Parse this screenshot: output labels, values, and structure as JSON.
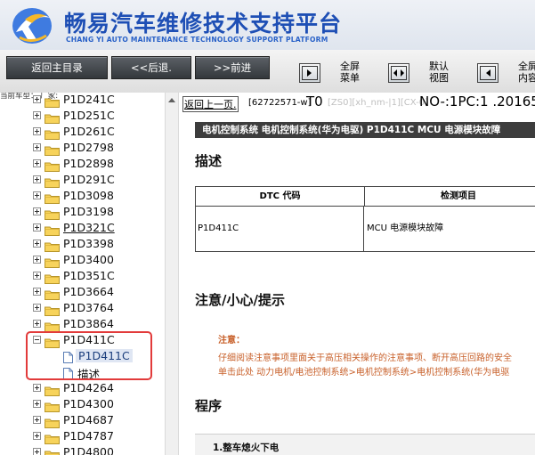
{
  "header": {
    "title": "畅易汽车维修技术支持平台",
    "subtitle": "CHANG YI AUTO MAINTENANCE TECHNOLOGY SUPPORT PLATFORM"
  },
  "toolbar": {
    "home_label": "返回主目录",
    "back_label": "<<后退.",
    "forward_label": ">>前进",
    "fullscreen_menu": [
      "全屏",
      "菜单"
    ],
    "default_view": [
      "默认",
      "视图"
    ],
    "fullscreen_content": [
      "全屏",
      "内容"
    ]
  },
  "tree": {
    "breadcrumb": "当前车型：  厂家:",
    "items": [
      {
        "label": "P1D241C"
      },
      {
        "label": "P1D251C"
      },
      {
        "label": "P1D261C"
      },
      {
        "label": "P1D2798"
      },
      {
        "label": "P1D2898"
      },
      {
        "label": "P1D291C"
      },
      {
        "label": "P1D3098"
      },
      {
        "label": "P1D3198"
      },
      {
        "label": "P1D321C"
      },
      {
        "label": "P1D3398"
      },
      {
        "label": "P1D3400"
      },
      {
        "label": "P1D351C"
      },
      {
        "label": "P1D3664"
      },
      {
        "label": "P1D3764"
      },
      {
        "label": "P1D3864"
      },
      {
        "label": "P1D411C"
      },
      {
        "label": "P1D4264"
      },
      {
        "label": "P1D4300"
      },
      {
        "label": "P1D4687"
      },
      {
        "label": "P1D4787"
      },
      {
        "label": "P1D4800"
      }
    ],
    "expanded_children": [
      {
        "label": "P1D411C",
        "selected": true
      },
      {
        "label": "描述",
        "selected": false
      }
    ]
  },
  "content": {
    "back_link": "返回上一页.",
    "info_id": "[62722571-w]",
    "info_t0": "T0",
    "info_gray": "[ZS0][xh_nm-|1][CX-0]",
    "info_no": "NO-:1PC:1 .20165",
    "breadcrumb": "电机控制系统  电机控制系统(华为电驱)  P1D411C  MCU 电源模块故障",
    "section_desc": "描述",
    "table": {
      "headers": [
        "DTC 代码",
        "检测项目"
      ],
      "rows": [
        [
          "P1D411C",
          "MCU 电源模块故障"
        ]
      ]
    },
    "section_notice": "注意/小心/提示",
    "caution_label": "注意：",
    "caution_lines": [
      "仔细阅读注意事项里面关于高压相关操作的注意事项、断开高压回路的安全",
      "单击此处 动力电机/电池控制系统>电机控制系统>电机控制系统(华为电驱"
    ],
    "section_procedure": "程序",
    "step1": "1.整车熄火下电"
  },
  "colors": {
    "brand_blue": "#1e4fb5",
    "breadbar_bg": "#3d3d3d",
    "caution_orange": "#c8602a",
    "highlight_red": "#e23b3b"
  }
}
